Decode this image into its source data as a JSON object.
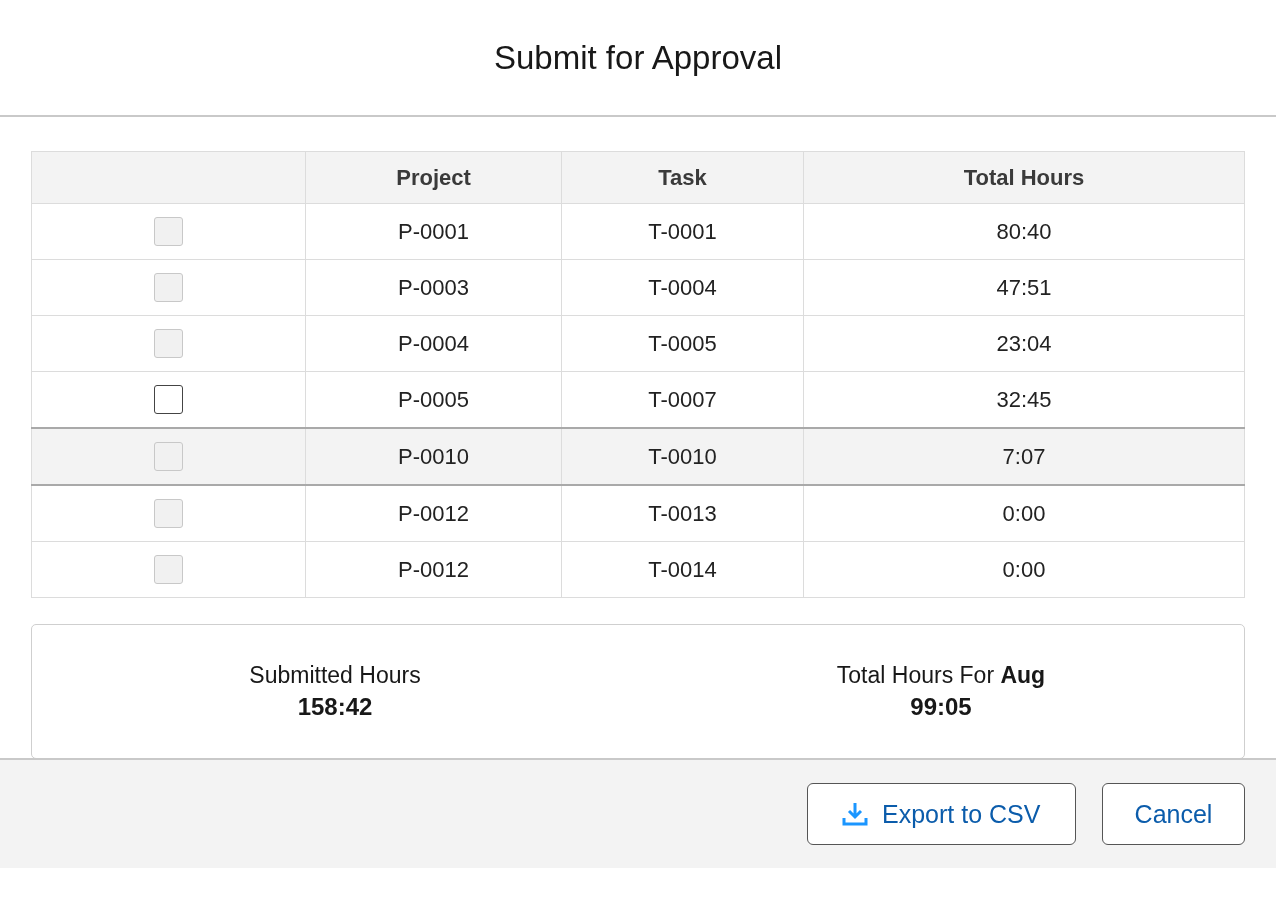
{
  "modal": {
    "title": "Submit for Approval"
  },
  "table": {
    "columns": [
      "Project",
      "Task",
      "Total Hours"
    ],
    "rows": [
      {
        "disabled": true,
        "selected": false,
        "project": "P-0001",
        "task": "T-0001",
        "total_hours": "80:40"
      },
      {
        "disabled": true,
        "selected": false,
        "project": "P-0003",
        "task": "T-0004",
        "total_hours": "47:51"
      },
      {
        "disabled": true,
        "selected": false,
        "project": "P-0004",
        "task": "T-0005",
        "total_hours": "23:04"
      },
      {
        "disabled": false,
        "selected": false,
        "project": "P-0005",
        "task": "T-0007",
        "total_hours": "32:45"
      },
      {
        "disabled": true,
        "selected": true,
        "project": "P-0010",
        "task": "T-0010",
        "total_hours": "7:07"
      },
      {
        "disabled": true,
        "selected": false,
        "project": "P-0012",
        "task": "T-0013",
        "total_hours": "0:00"
      },
      {
        "disabled": true,
        "selected": false,
        "project": "P-0012",
        "task": "T-0014",
        "total_hours": "0:00"
      }
    ]
  },
  "summary": [
    {
      "label": "Submitted Hours",
      "value": "158:42"
    },
    {
      "label": "Total Hours For **Aug**",
      "value": "99:05"
    }
  ],
  "footer": {
    "buttons": [
      {
        "kind": "export",
        "label": "Export to CSV"
      },
      {
        "kind": "plain",
        "label": "Cancel"
      }
    ]
  }
}
